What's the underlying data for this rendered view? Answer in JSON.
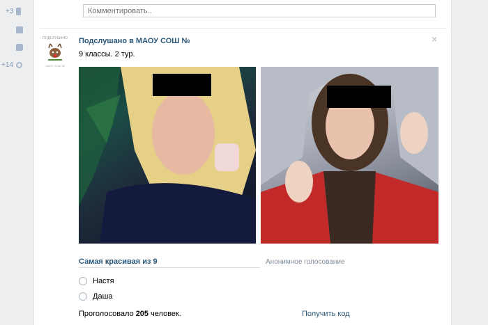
{
  "left_rail": {
    "items": [
      {
        "count": "+3",
        "icon": "phone-icon"
      },
      {
        "count": "",
        "icon": "mail-icon"
      },
      {
        "count": "",
        "icon": "comment-icon"
      },
      {
        "count": "+14",
        "icon": "gear-icon"
      }
    ]
  },
  "comment": {
    "placeholder": "Комментировать.."
  },
  "post": {
    "avatar_caption": "ПОДСЛУШАНО",
    "avatar_footer": "МАОУ СОШ №",
    "title": "Подслушано в МАОУ СОШ №",
    "text": "9 классы. 2 тур.",
    "close_glyph": "×"
  },
  "poll": {
    "title": "Самая красивая из 9",
    "type": "Анонимное голосование",
    "options": [
      {
        "label": "Настя"
      },
      {
        "label": "Даша"
      }
    ],
    "votes_prefix": "Проголосовало",
    "votes_count": "205",
    "votes_suffix": "человек.",
    "get_code": "Получить код"
  },
  "colors": {
    "link": "#2b587a",
    "background": "#edeef0",
    "panel": "#ffffff"
  }
}
